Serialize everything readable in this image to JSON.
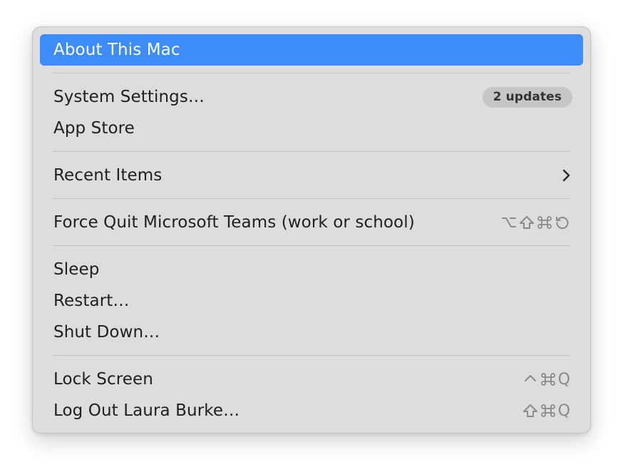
{
  "menu": {
    "about": "About This Mac",
    "settings": {
      "label": "System Settings…",
      "badge": "2 updates"
    },
    "app_store": "App Store",
    "recent_items": "Recent Items",
    "force_quit": {
      "label": "Force Quit Microsoft Teams (work or school)"
    },
    "sleep": "Sleep",
    "restart": "Restart…",
    "shutdown": "Shut Down…",
    "lock_screen": {
      "label": "Lock Screen",
      "key": "Q"
    },
    "log_out": {
      "label": "Log Out Laura Burke…",
      "key": "Q"
    }
  },
  "colors": {
    "highlight": "#3d8cf7",
    "menu_bg": "#dddddf",
    "badge_bg": "#c6c6c9",
    "shortcut": "#8a8a8d"
  }
}
